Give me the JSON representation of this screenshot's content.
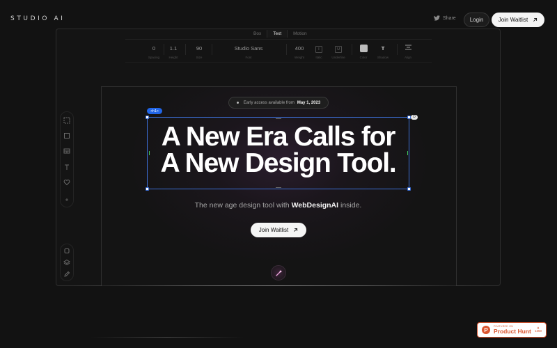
{
  "brand": {
    "logo": "STUDIO AI"
  },
  "nav": {
    "share_label": "Share",
    "login_label": "Login",
    "join_label": "Join Waitlist"
  },
  "editor": {
    "tabs": [
      {
        "label": "Box"
      },
      {
        "label": "Text"
      },
      {
        "label": "Motion"
      }
    ],
    "active_tab": "Text",
    "toolbar": {
      "spacing": {
        "value": "0",
        "label": "Spacing"
      },
      "height": {
        "value": "1.1",
        "label": "Height"
      },
      "size": {
        "value": "90",
        "label": "Size"
      },
      "font": {
        "value": "Studio Sans",
        "label": "Font"
      },
      "weight": {
        "value": "400",
        "label": "Weight"
      },
      "italic": {
        "glyph": "I",
        "label": "Italic"
      },
      "underline": {
        "glyph": "U",
        "label": "Underline"
      },
      "color": {
        "label": "Color",
        "swatch": "#bdbdbd"
      },
      "shadow": {
        "glyph": "T",
        "label": "Shadow"
      },
      "align": {
        "label": "Align"
      }
    },
    "element_tag": "<h1>",
    "corner_badge": "D"
  },
  "hero": {
    "badge_prefix": "Early access available from",
    "badge_date": "May 1, 2023",
    "heading_line1": "A New Era Calls for",
    "heading_line2": "A New Design Tool.",
    "subtitle_prefix": "The new age design tool with",
    "subtitle_brand": "WebDesignAI",
    "subtitle_suffix": "inside.",
    "cta_label": "Join Waitlist"
  },
  "product_hunt": {
    "small": "FEATURED ON",
    "title": "Product Hunt",
    "count": "1350"
  },
  "colors": {
    "accent_blue": "#2166e8",
    "product_hunt": "#da552f",
    "background": "#121212"
  }
}
